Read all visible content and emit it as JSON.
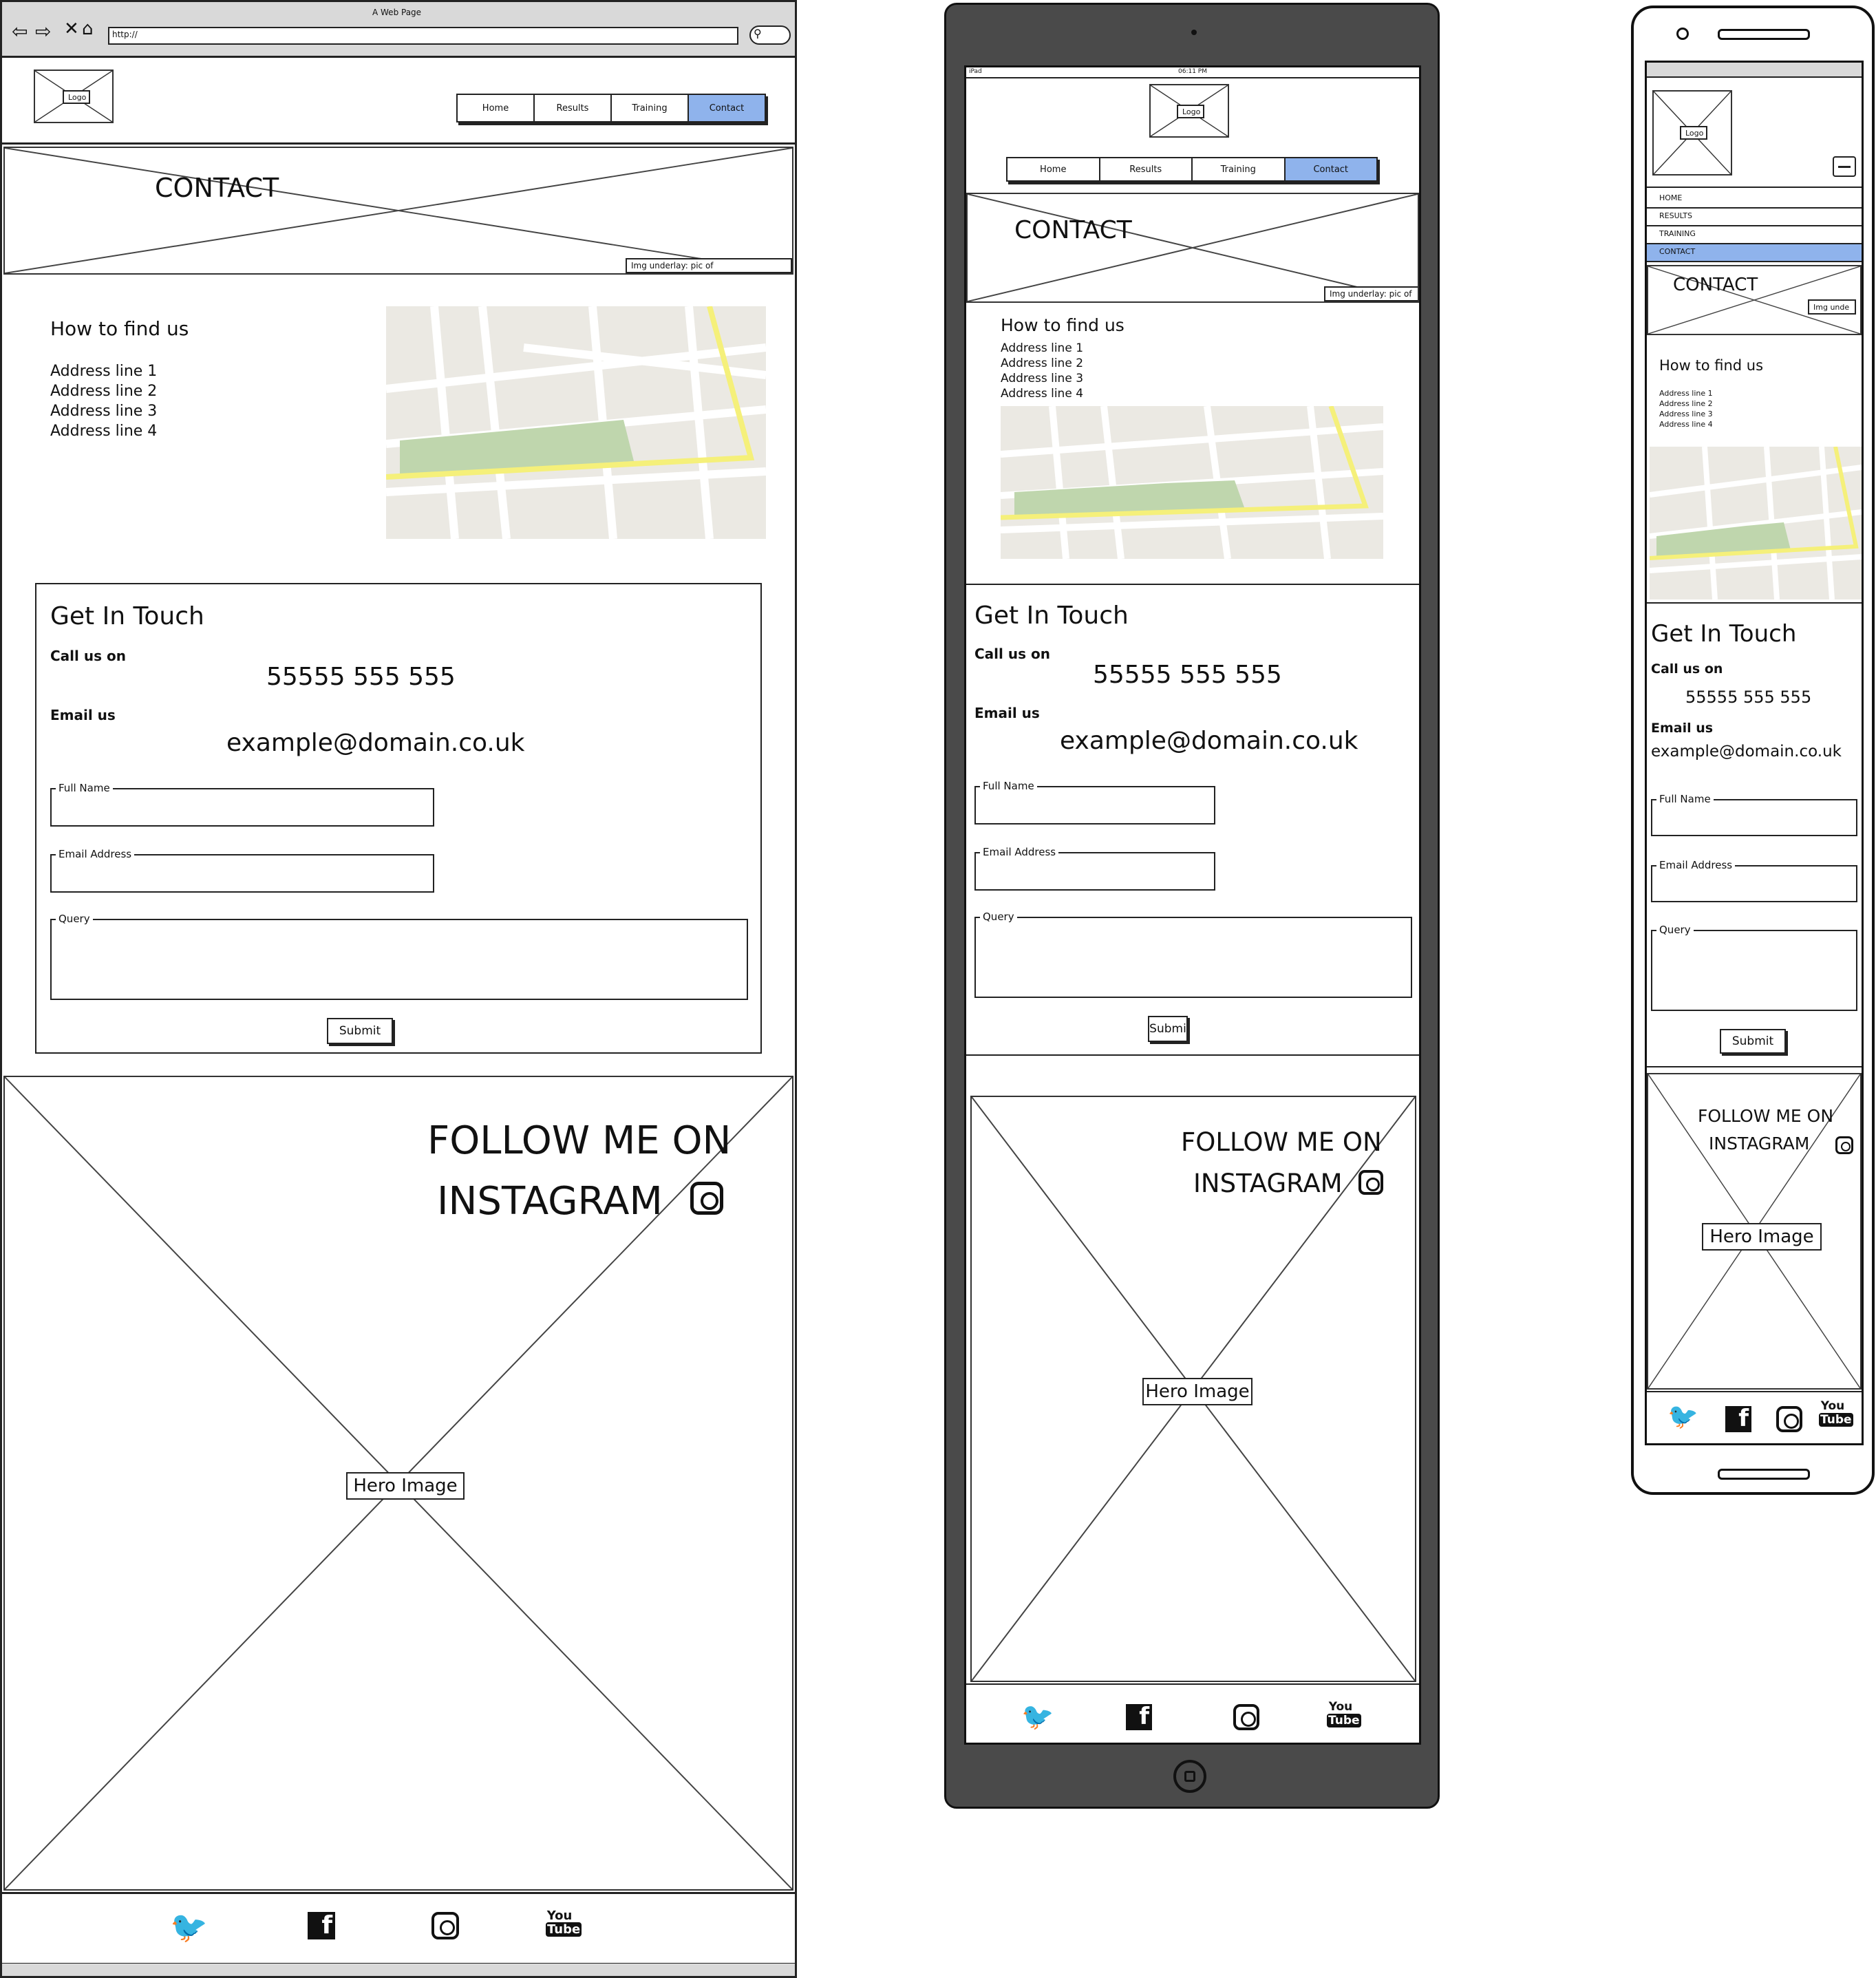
{
  "browser": {
    "title": "A Web Page",
    "url": "http://"
  },
  "logo_label": "Logo",
  "nav": {
    "items": [
      "Home",
      "Results",
      "Training",
      "Contact"
    ],
    "active": "Contact"
  },
  "mobile_nav": {
    "items": [
      "HOME",
      "RESULTS",
      "TRAINING",
      "CONTACT"
    ]
  },
  "tablet_status": {
    "device": "iPad",
    "time": "06:11 PM"
  },
  "banner": {
    "title": "CONTACT",
    "underlay_note": "Img underlay: pic of",
    "underlay_note_mobile": "Img unde"
  },
  "find_us": {
    "heading": "How to find us",
    "address": [
      "Address line 1",
      "Address line 2",
      "Address line 3",
      "Address line 4"
    ]
  },
  "contact": {
    "heading": "Get In Touch",
    "call_label": "Call us on",
    "phone": "55555 555 555",
    "email_label": "Email us",
    "email": "example@domain.co.uk",
    "fields": {
      "full_name": "Full Name",
      "email_address": "Email Address",
      "query": "Query"
    },
    "submit": "Submit",
    "submit_tablet": "Submi"
  },
  "instagram": {
    "line1": "FOLLOW ME ON",
    "line2": "INSTAGRAM",
    "hero_label": "Hero Image"
  },
  "social": [
    "twitter-icon",
    "facebook-icon",
    "instagram-icon",
    "youtube-icon"
  ],
  "colors": {
    "nav_active": "#8fb3ec",
    "device_body": "#4a4a4a",
    "map_bg": "#ebe9e3",
    "map_park": "#bfd6ad",
    "map_route": "#f5f07a"
  }
}
